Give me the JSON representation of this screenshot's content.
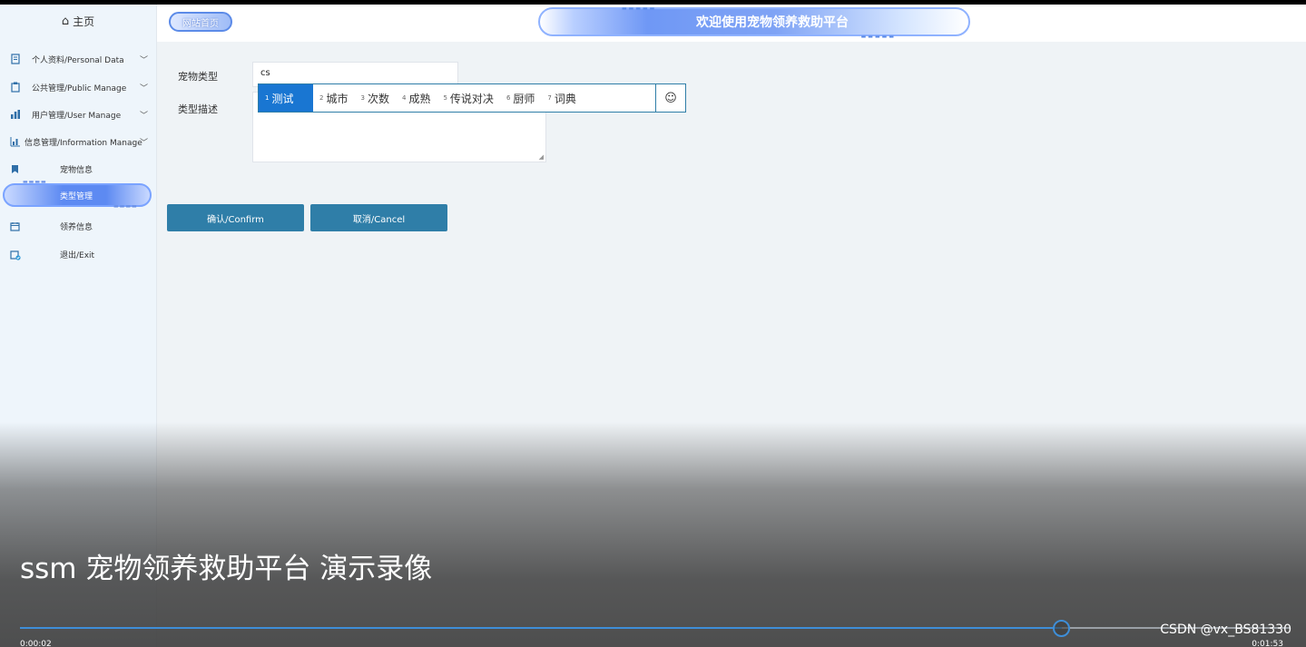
{
  "sidebar": {
    "home_label": "主页",
    "menus": [
      {
        "label": "个人资料/Personal Data",
        "icon": "document-icon"
      },
      {
        "label": "公共管理/Public Manage",
        "icon": "clipboard-icon"
      },
      {
        "label": "用户管理/User Manage",
        "icon": "bar-chart-icon"
      },
      {
        "label": "信息管理/Information Manage",
        "icon": "chart-icon"
      }
    ],
    "sub_items": [
      {
        "label": "宠物信息",
        "icon": "bookmark-icon"
      },
      {
        "label": "类型管理",
        "icon": "",
        "active": true
      },
      {
        "label": "领养信息",
        "icon": "calendar-icon"
      },
      {
        "label": "退出/Exit",
        "icon": "calendar-check-icon"
      }
    ]
  },
  "header": {
    "site_home": "网站首页",
    "welcome": "欢迎使用宠物领养救助平台"
  },
  "form": {
    "pet_type_label": "宠物类型",
    "pet_type_value": "cs",
    "type_desc_label": "类型描述",
    "confirm_label": "确认/Confirm",
    "cancel_label": "取消/Cancel"
  },
  "ime": {
    "candidates": [
      {
        "n": "1",
        "text": "测试"
      },
      {
        "n": "2",
        "text": "城市"
      },
      {
        "n": "3",
        "text": "次数"
      },
      {
        "n": "4",
        "text": "成熟"
      },
      {
        "n": "5",
        "text": "传说对决"
      },
      {
        "n": "6",
        "text": "厨师"
      },
      {
        "n": "7",
        "text": "词典"
      }
    ],
    "emoji": "☺"
  },
  "video": {
    "title": "ssm 宠物领养救助平台 演示录像",
    "time_current": "0:00:02",
    "time_total": "0:01:53",
    "progress": 0.82,
    "watermark": "CSDN @vx_BS81330"
  },
  "colors": {
    "accent": "#2f7ea8",
    "highlight": "#5d8af2",
    "ime_selected": "#1976d2"
  }
}
